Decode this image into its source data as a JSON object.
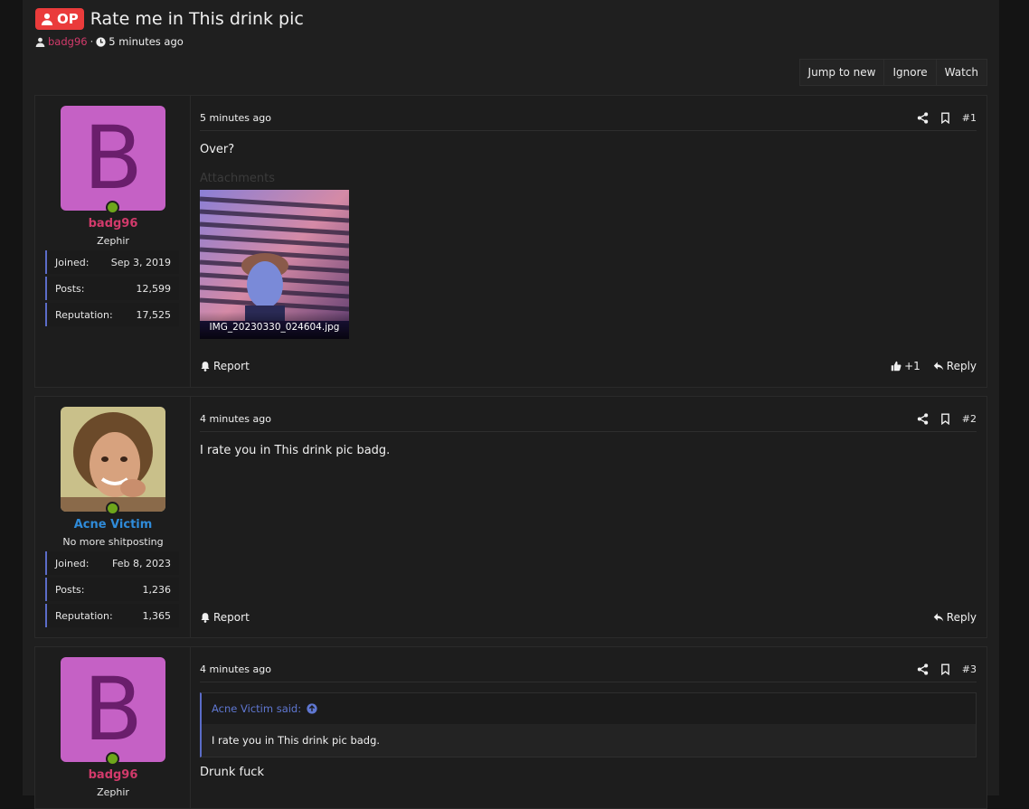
{
  "thread": {
    "op_badge": "OP",
    "title": "Rate me in This drink pic",
    "author": "badg96",
    "separator": "·",
    "time": "5 minutes ago"
  },
  "toolbar": {
    "jump_to_new": "Jump to new",
    "ignore": "Ignore",
    "watch": "Watch"
  },
  "posts": [
    {
      "username": "badg96",
      "username_color": "#d23a6b",
      "avatar_letter": "B",
      "user_title": "Zephir",
      "stats": [
        {
          "label": "Joined:",
          "value": "Sep 3, 2019"
        },
        {
          "label": "Posts:",
          "value": "12,599"
        },
        {
          "label": "Reputation:",
          "value": "17,525"
        }
      ],
      "time": "5 minutes ago",
      "number": "#1",
      "body": "Over?",
      "attachments_label": "Attachments",
      "attachment_name": "IMG_20230330_024604.jpg",
      "report": "Report",
      "like_count": "+1",
      "reply": "Reply"
    },
    {
      "username": "Acne Victim",
      "username_color": "#2f8bd9",
      "user_title": "No more shitposting",
      "stats": [
        {
          "label": "Joined:",
          "value": "Feb 8, 2023"
        },
        {
          "label": "Posts:",
          "value": "1,236"
        },
        {
          "label": "Reputation:",
          "value": "1,365"
        }
      ],
      "time": "4 minutes ago",
      "number": "#2",
      "body": "I rate you in This drink pic badg.",
      "report": "Report",
      "reply": "Reply"
    },
    {
      "username": "badg96",
      "username_color": "#d23a6b",
      "avatar_letter": "B",
      "user_title": "Zephir",
      "time": "4 minutes ago",
      "number": "#3",
      "quote_author": "Acne Victim said:",
      "quote_body": "I rate you in This drink pic badg.",
      "body": "Drunk fuck"
    }
  ],
  "colors": {
    "accent_blue": "#5b6cc8",
    "op_red": "#ea3b3b",
    "online_green": "#6ea61b",
    "avatar_purple": "#c561c5"
  }
}
